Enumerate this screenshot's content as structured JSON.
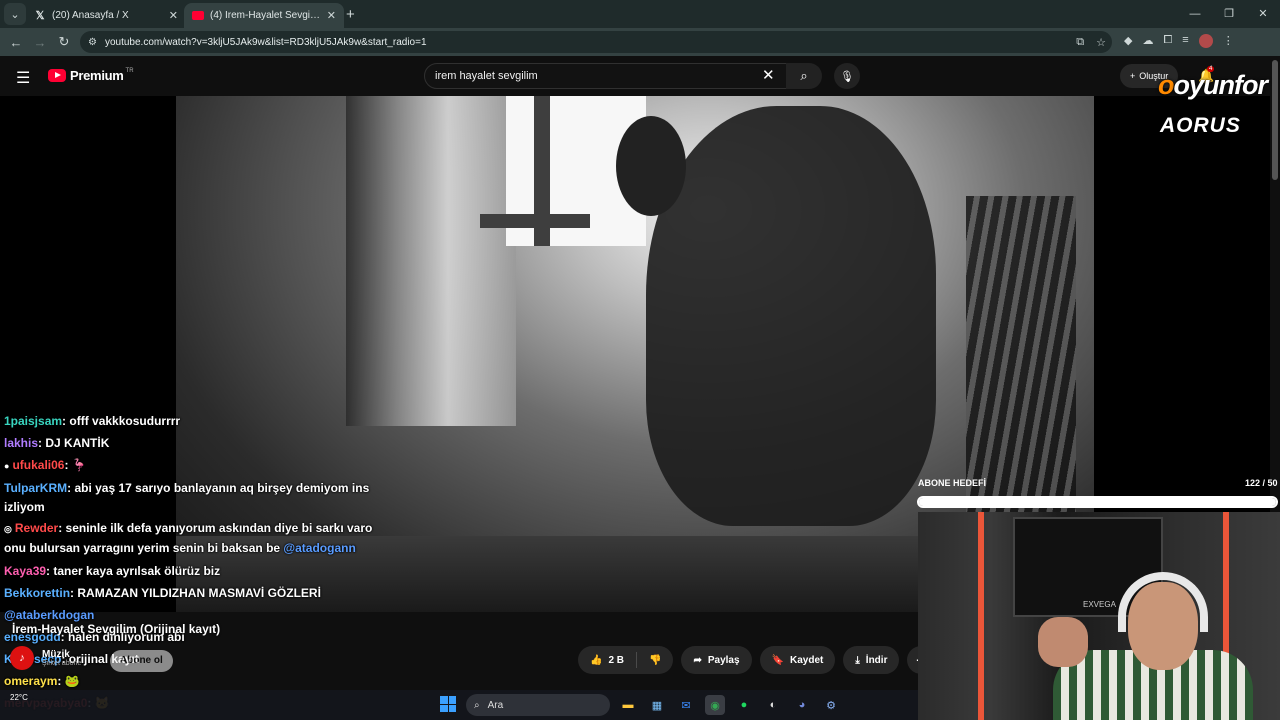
{
  "browser": {
    "tabs": [
      {
        "title": "(20) Anasayfa / X",
        "favicon": "x-icon"
      },
      {
        "title": "(4) İrem-Hayalet Sevgilim (",
        "favicon": "youtube-icon"
      }
    ],
    "url": "youtube.com/watch?v=3kljU5JAk9w&list=RD3kljU5JAk9w&start_radio=1"
  },
  "youtube": {
    "brand": "Premium",
    "country": "TR",
    "search_value": "irem hayalet sevgilim",
    "create_label": "Oluştur",
    "notif_count": "4"
  },
  "overlay": {
    "logo_oyun": "oyunfor",
    "logo_aorus": "AORUS",
    "goal_label": "ABONE HEDEFİ",
    "goal_count": "122 / 50",
    "goal_progress": 1.0,
    "cam_label": "EXVEGA"
  },
  "chat": [
    {
      "user": "1paisjsam",
      "text": ": offf vakkkosudurrrr",
      "color": "teal"
    },
    {
      "user": "lakhis",
      "text": ": DJ KANTİK",
      "color": "purple"
    },
    {
      "user": "ufukali06",
      "text": ": 🦩",
      "color": "red",
      "badge": "●"
    },
    {
      "user": "TulparKRM",
      "text": ": abi yaş 17 sarıyo banlayanın aq birşey demiyom ins izliyom",
      "color": "blue",
      "wrap": true
    },
    {
      "user": "Rewder",
      "text": ": seninle ilk defa yanıyorum askından diye bi sarkı varo onu bulursan yarragını yerim senin bi baksan be",
      "mention": "@atadogann",
      "color": "red",
      "badge": "◎",
      "wrap": true
    },
    {
      "user": "Kaya39",
      "text": ": taner kaya ayrılsak ölürüz biz",
      "color": "pink"
    },
    {
      "user": "Bekkorettin",
      "text": ": RAMAZAN YILDIZHAN MASMAVİ GÖZLERİ",
      "color": "blue"
    },
    {
      "user": "@ataberkdogan",
      "text": "",
      "color": "mention"
    },
    {
      "user": "enesgodd",
      "text": ": halen dinliyorum abi",
      "color": "blue"
    },
    {
      "user": "Kuyosecp",
      "text": ": orijinal kayıt",
      "color": "blue"
    },
    {
      "user": "omeraym",
      "text": ": 🐸",
      "color": "yellow"
    },
    {
      "user": "mervpayabya0",
      "text": ": 🐱",
      "color": "red"
    }
  ],
  "video": {
    "title": "İrem-Hayalet Sevgilim (Orijinal kayıt)",
    "channel": "Müzik",
    "subs": "Şirket abone",
    "subscribe_label": "Abone ol",
    "likes": "2 B",
    "share_label": "Paylaş",
    "save_label": "Kaydet",
    "download_label": "İndir"
  },
  "taskbar": {
    "temp": "22°C",
    "search_placeholder": "Ara"
  }
}
